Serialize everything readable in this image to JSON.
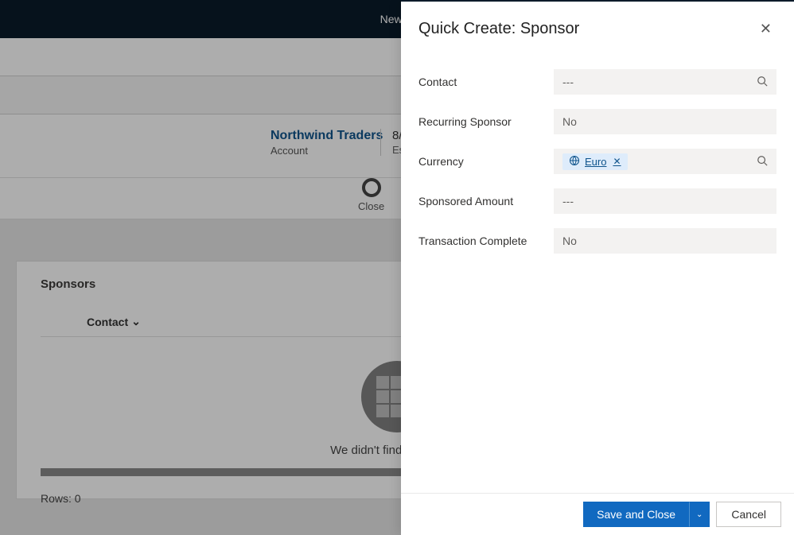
{
  "background": {
    "topbar_text": "New lo",
    "record_name": "Northwind Traders",
    "record_type": "Account",
    "record_date_line1": "8/",
    "record_date_line2": "Est",
    "stage_label": "Close",
    "sponsors_title": "Sponsors",
    "grid_column": "Contact",
    "empty_message": "We didn't find anything to",
    "rows_label": "Rows: 0"
  },
  "panel": {
    "title": "Quick Create: Sponsor",
    "fields": {
      "contact_label": "Contact",
      "contact_value": "---",
      "recurring_label": "Recurring Sponsor",
      "recurring_value": "No",
      "currency_label": "Currency",
      "currency_chip": "Euro",
      "amount_label": "Sponsored Amount",
      "amount_value": "---",
      "complete_label": "Transaction Complete",
      "complete_value": "No"
    },
    "save_label": "Save and Close",
    "cancel_label": "Cancel"
  }
}
